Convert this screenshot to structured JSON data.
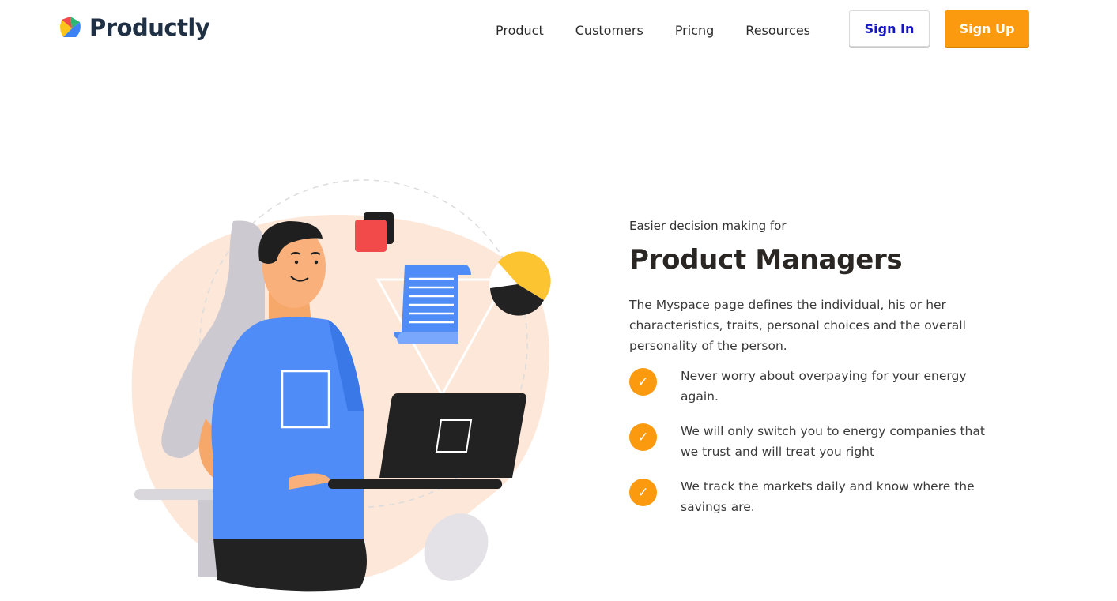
{
  "brand": {
    "name": "Productly"
  },
  "nav": {
    "items": [
      "Product",
      "Customers",
      "Pricng",
      "Resources"
    ]
  },
  "actions": {
    "sign_in": "Sign In",
    "sign_up": "Sign Up"
  },
  "hero": {
    "eyebrow": "Easier decision making for",
    "title": "Product Managers",
    "description": "The Myspace page defines the individual, his or her characteristics, traits, personal choices and the overall personality of the person.",
    "features": [
      "Never worry about overpaying for your energy again.",
      "We will only switch you to energy companies that we trust and will treat you right",
      "We track the markets daily and know where the savings are."
    ]
  },
  "icons": {
    "check": "✓",
    "logo": "productly-logo-icon"
  },
  "colors": {
    "accent": "#fb9a0e",
    "brand_text": "#1f3044",
    "sign_in_text": "#1515c8",
    "blob": "#fde7d9",
    "shirt": "#4f8cf7"
  }
}
